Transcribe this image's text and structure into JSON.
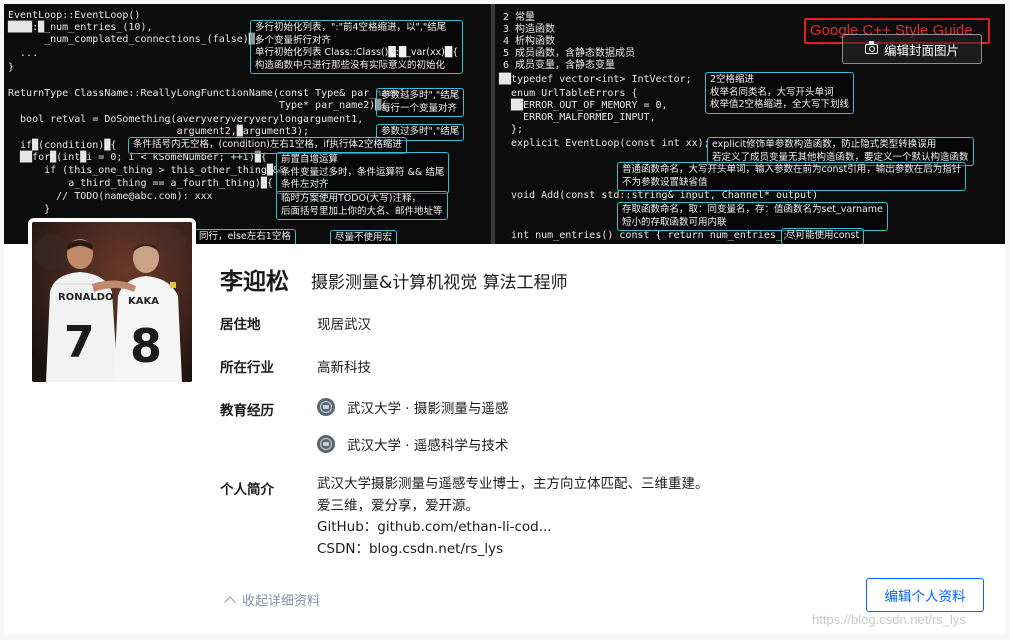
{
  "cover": {
    "left_code": [
      "EventLoop::EventLoop()",
      "████:█_num_entries_(10),",
      "      _num_complated_connections_(false)█{",
      "  ...",
      "}",
      "",
      "ReturnType ClassName::ReallyLongFunctionName(const Type& par_name1,",
      "                                             Type* par_name2)█{",
      "  bool retval = DoSomething(averyveryveryverylongargument1,",
      "                            argument2,█argument3);",
      "  if█(condition)█{",
      "  ██for█(int█i = 0; i < kSomeNumber; ++i)█{",
      "      if (this_one_thing > this_other_thing█&&",
      "          a_third_thing == a_fourth_thing)█{",
      "        // TODO(name@abc.com): xxx",
      "      }"
    ],
    "right_code": [
      "2 常量",
      "3 构造函数",
      "4 析构函数",
      "5 成员函数，含静态数据成员",
      "6 成员变量，含静态变量",
      "██typedef vector<int> IntVector;",
      "  enum UrlTableErrors {",
      "  ██ERROR_OUT_OF_MEMORY = 0,",
      "    ERROR_MALFORMED_INPUT,",
      "  };",
      "  explicit EventLoop(const int xx);",
      "",
      "",
      "",
      "  void Add(const std::string& input, Channel* output)",
      "",
      "",
      "",
      "  int num_entries() const { return num_entries_; }"
    ],
    "notes": {
      "n1": "多行初始化列表，\":\"前4空格缩进，以\",\"结尾\n多个变量折行对齐\n单行初始化列表 Class::Class()█:█_var(xx)█{\n构造函数中只进行那些没有实际意义的初始化",
      "n2": "参数过多时\",\"结尾\n每行一个变量对齐",
      "n3": "参数过多时\",\"结尾",
      "n4": "条件括号内无空格，(condition)左右1空格，if执行体2空格缩进",
      "n5": "前置自增运算\n条件变量过多时，条件运算符 && 结尾\n条件左对齐",
      "n6": "临时方案使用TODO(大写)注释，\n后面括号里加上你的大名、邮件地址等",
      "n7": "尽量不使用宏",
      "n8": "2空格缩进\n枚举名同类名，大写开头单词\n枚举值2空格缩进，全大写下划线",
      "n9": "explicit修饰单参数构造函数，防止隐式类型转换误用\n若定义了成员变量无其他构造函数，要定义一个默认构造函数",
      "n10": "普通函数命名，大写开头单词，输入参数在前为const引用，输出参数在后为指针\n不为参数设置缺省值",
      "n11": "存取函数命名，取：同变量名，存：值函数名为set_varname\n短小的存取函数可用内联",
      "n12": "尽可能使用const",
      "n13": "同行，else左右1空格"
    },
    "style_guide": "Google C++ Style Guide",
    "edit_cover_label": "编辑封面图片"
  },
  "profile": {
    "name": "李迎松",
    "headline": "摄影测量&计算机视觉 算法工程师",
    "location_label": "居住地",
    "location_value": "现居武汉",
    "industry_label": "所在行业",
    "industry_value": "高新科技",
    "education_label": "教育经历",
    "education": [
      "武汉大学 · 摄影测量与遥感",
      "武汉大学 · 遥感科学与技术"
    ],
    "bio_label": "个人简介",
    "bio_lines": [
      "武汉大学摄影测量与遥感专业博士，主方向立体匹配、三维重建。",
      "爱三维，爱分享，爱开源。",
      "GitHub：github.com/ethan-li-cod...",
      "CSDN：blog.csdn.net/rs_lys"
    ],
    "collapse_label": "收起详细资料",
    "edit_profile_label": "编辑个人资料"
  },
  "watermark": "https://blog.csdn.net/rs_lys",
  "colors": {
    "accent": "#0066ff",
    "note_border": "#36c0d8",
    "guide_red": "#e02020",
    "muted": "#8590a6"
  }
}
